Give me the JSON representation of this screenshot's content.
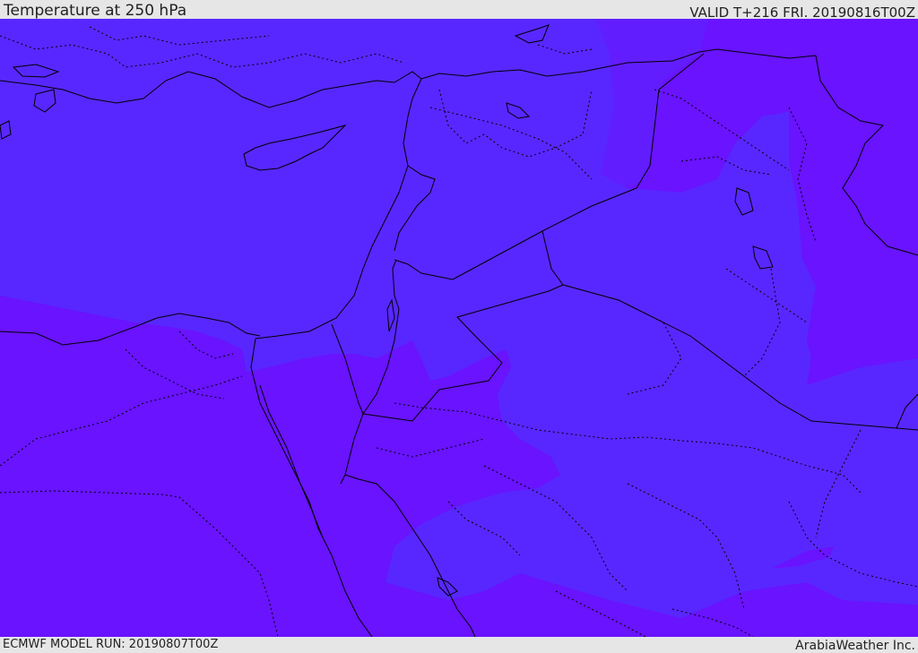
{
  "header": {
    "title": "Temperature at 250 hPa",
    "valid": "VALID T+216 FRI. 20190816T00Z"
  },
  "footer": {
    "model_run": "ECMWF MODEL RUN: 20190807T00Z",
    "credit": "ArabiaWeather Inc."
  },
  "map": {
    "colors": {
      "cool_band": "#5827ff",
      "warm_band": "#6913fe",
      "border_line": "#000000"
    }
  }
}
